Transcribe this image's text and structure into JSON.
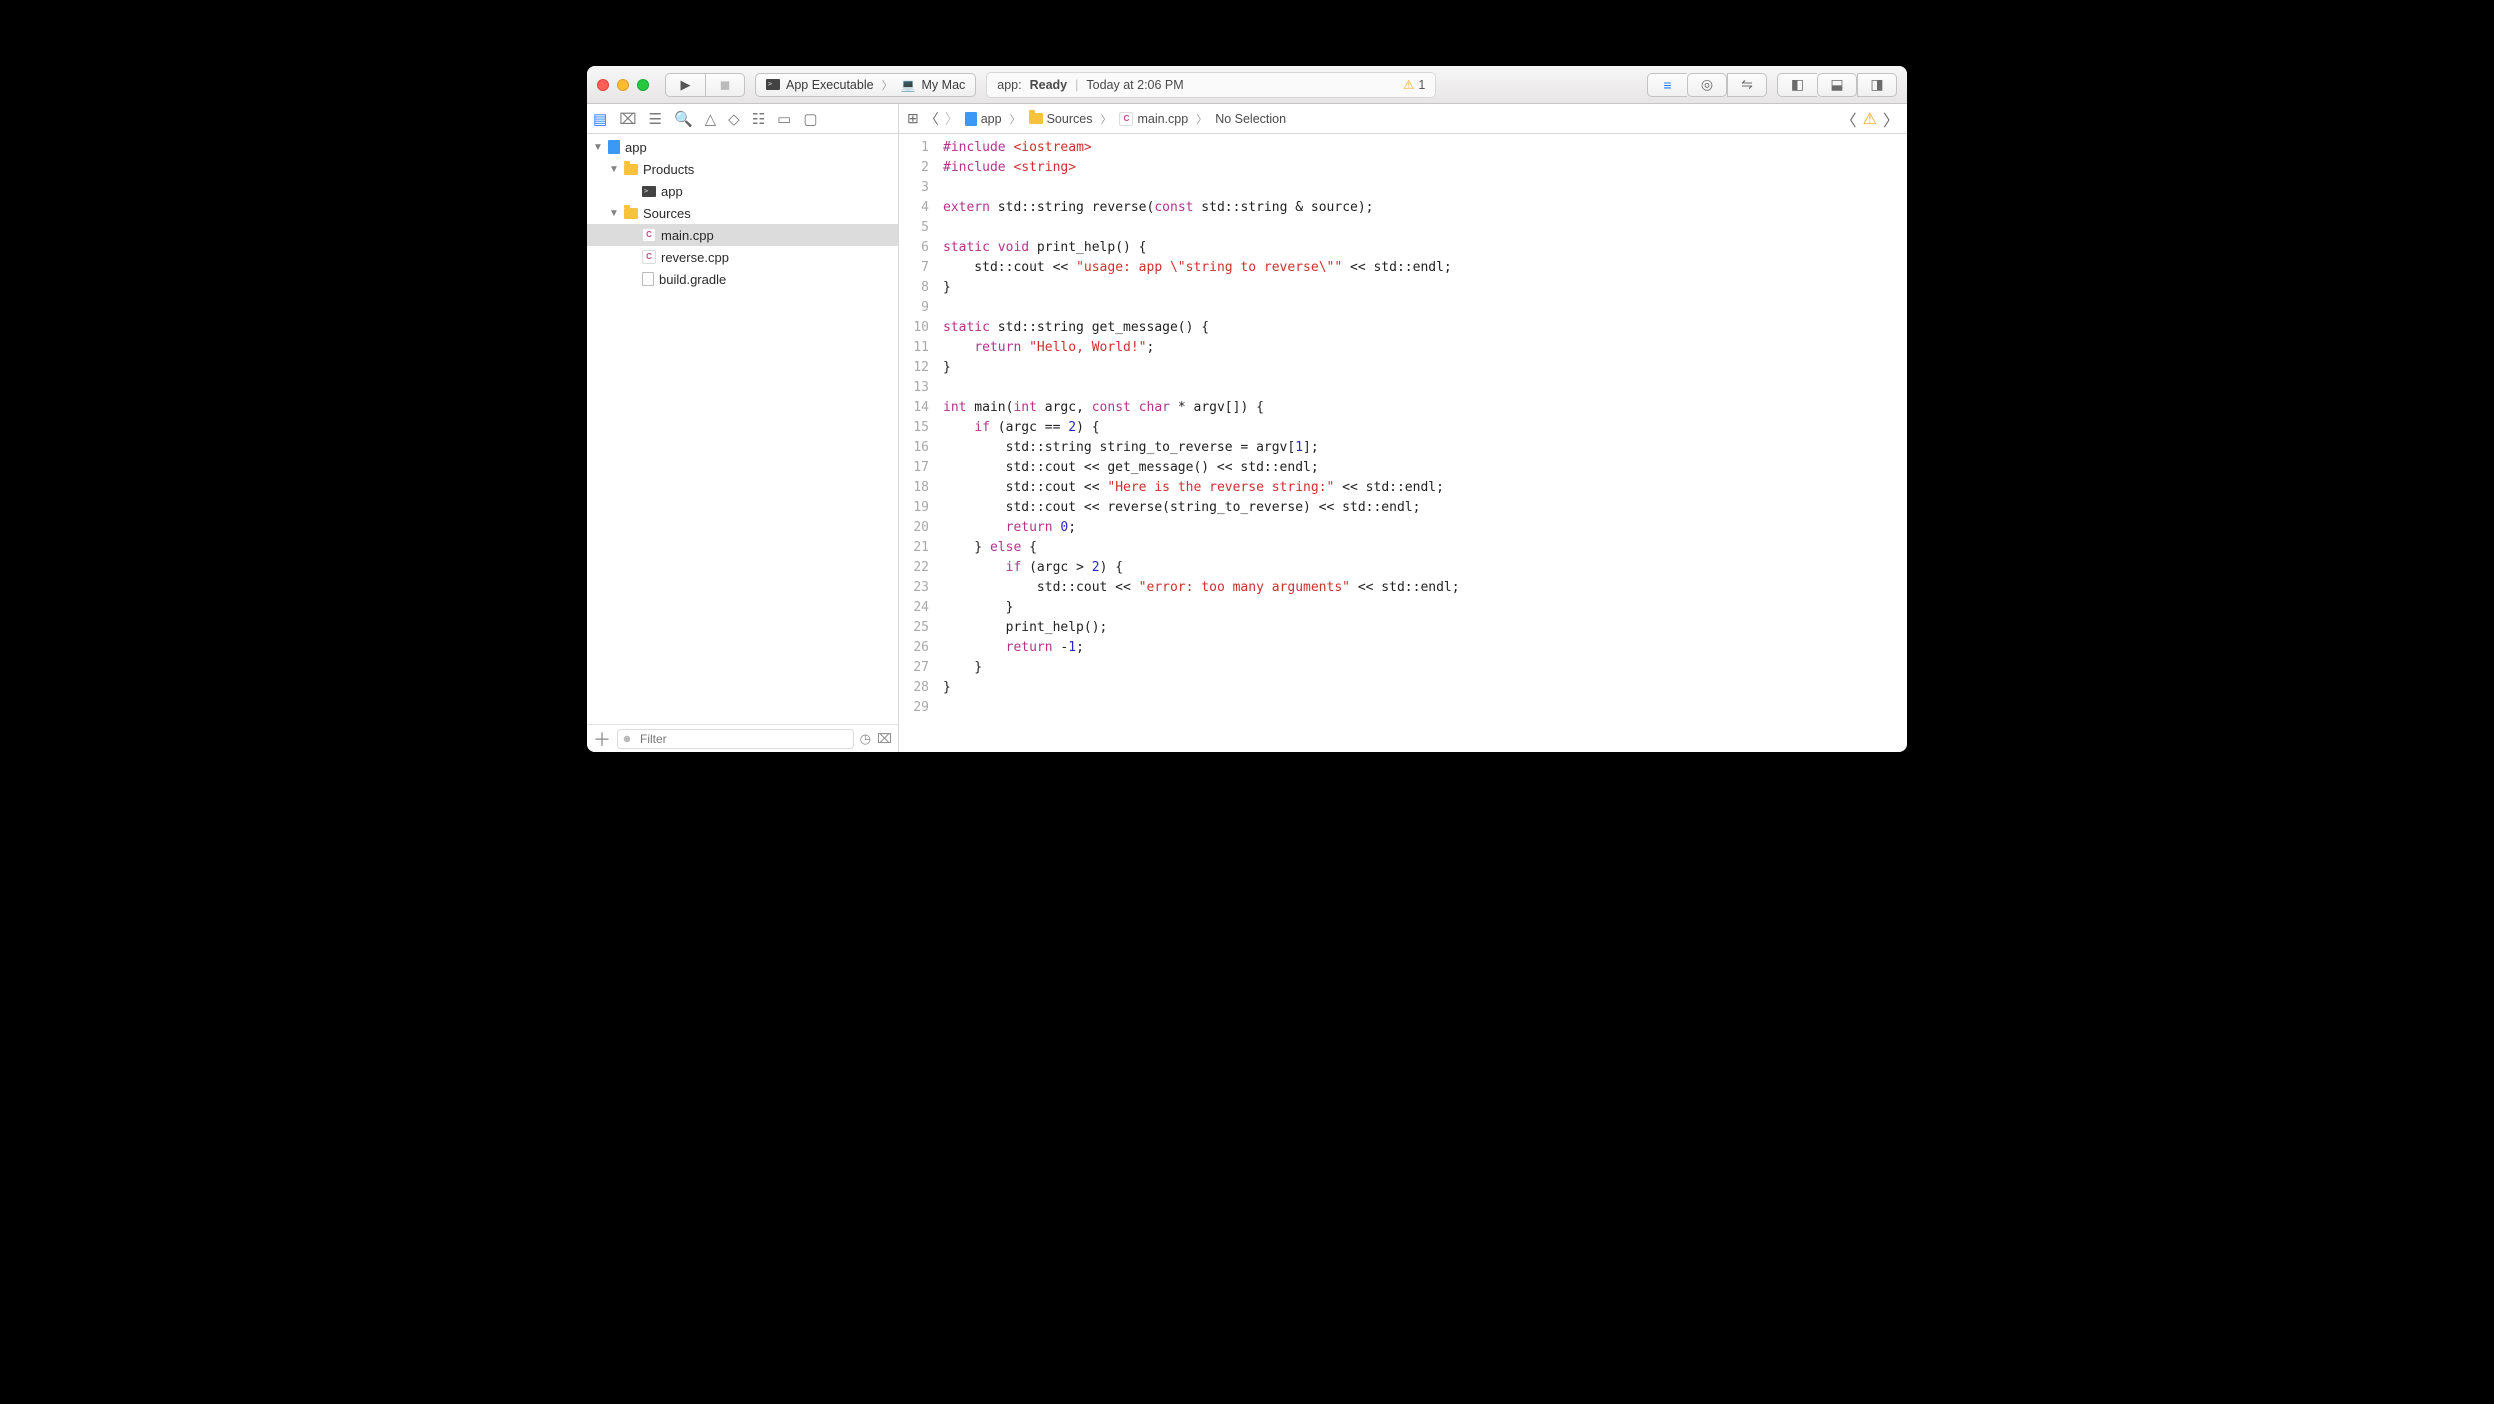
{
  "scheme": {
    "target": "App Executable",
    "destination": "My Mac"
  },
  "status": {
    "app": "app:",
    "state": "Ready",
    "time": "Today at 2:06 PM",
    "warn_count": "1"
  },
  "breadcrumb": {
    "root": "app",
    "folder": "Sources",
    "file": "main.cpp",
    "selection": "No Selection"
  },
  "tree": {
    "root": "app",
    "products": "Products",
    "products_item": "app",
    "sources": "Sources",
    "main": "main.cpp",
    "reverse": "reverse.cpp",
    "gradle": "build.gradle"
  },
  "filter": {
    "placeholder": "Filter"
  },
  "code": {
    "lines": [
      [
        [
          "kw",
          "#include "
        ],
        [
          "hdr",
          "<iostream>"
        ]
      ],
      [
        [
          "kw",
          "#include "
        ],
        [
          "hdr",
          "<string>"
        ]
      ],
      [
        [
          "",
          " "
        ]
      ],
      [
        [
          "kw",
          "extern"
        ],
        [
          "",
          " std::string reverse("
        ],
        [
          "kw",
          "const"
        ],
        [
          "",
          " std::string & source);"
        ]
      ],
      [
        [
          "",
          " "
        ]
      ],
      [
        [
          "kw",
          "static"
        ],
        [
          "",
          " "
        ],
        [
          "kw",
          "void"
        ],
        [
          "",
          " print_help() {"
        ]
      ],
      [
        [
          "",
          "    std::cout << "
        ],
        [
          "hdr",
          "\"usage: app \\\"string to reverse\\\"\""
        ],
        [
          "",
          " << std::endl;"
        ]
      ],
      [
        [
          "",
          "}"
        ]
      ],
      [
        [
          "",
          " "
        ]
      ],
      [
        [
          "kw",
          "static"
        ],
        [
          "",
          " std::string get_message() {"
        ]
      ],
      [
        [
          "",
          "    "
        ],
        [
          "kw",
          "return"
        ],
        [
          "",
          " "
        ],
        [
          "hdr",
          "\"Hello, World!\""
        ],
        [
          "",
          ";"
        ]
      ],
      [
        [
          "",
          "}"
        ]
      ],
      [
        [
          "",
          " "
        ]
      ],
      [
        [
          "kw",
          "int"
        ],
        [
          "",
          " main("
        ],
        [
          "kw",
          "int"
        ],
        [
          "",
          " argc, "
        ],
        [
          "kw",
          "const"
        ],
        [
          "",
          " "
        ],
        [
          "kw",
          "char"
        ],
        [
          "",
          " * argv[]) {"
        ]
      ],
      [
        [
          "",
          "    "
        ],
        [
          "kw",
          "if"
        ],
        [
          "",
          " (argc == "
        ],
        [
          "num",
          "2"
        ],
        [
          "",
          ") {"
        ]
      ],
      [
        [
          "",
          "        std::string string_to_reverse = argv["
        ],
        [
          "num",
          "1"
        ],
        [
          "",
          "];"
        ]
      ],
      [
        [
          "",
          "        std::cout << get_message() << std::endl;"
        ]
      ],
      [
        [
          "",
          "        std::cout << "
        ],
        [
          "hdr",
          "\"Here is the reverse string:\""
        ],
        [
          "",
          " << std::endl;"
        ]
      ],
      [
        [
          "",
          "        std::cout << reverse(string_to_reverse) << std::endl;"
        ]
      ],
      [
        [
          "",
          "        "
        ],
        [
          "kw",
          "return"
        ],
        [
          "",
          " "
        ],
        [
          "num",
          "0"
        ],
        [
          "",
          ";"
        ]
      ],
      [
        [
          "",
          "    } "
        ],
        [
          "kw",
          "else"
        ],
        [
          "",
          " {"
        ]
      ],
      [
        [
          "",
          "        "
        ],
        [
          "kw",
          "if"
        ],
        [
          "",
          " (argc > "
        ],
        [
          "num",
          "2"
        ],
        [
          "",
          ") {"
        ]
      ],
      [
        [
          "",
          "            std::cout << "
        ],
        [
          "hdr",
          "\"error: too many arguments\""
        ],
        [
          "",
          " << std::endl;"
        ]
      ],
      [
        [
          "",
          "        }"
        ]
      ],
      [
        [
          "",
          "        print_help();"
        ]
      ],
      [
        [
          "",
          "        "
        ],
        [
          "kw",
          "return"
        ],
        [
          "",
          " -"
        ],
        [
          "num",
          "1"
        ],
        [
          "",
          ";"
        ]
      ],
      [
        [
          "",
          "    }"
        ]
      ],
      [
        [
          "",
          "}"
        ]
      ],
      [
        [
          "",
          " "
        ]
      ]
    ]
  }
}
